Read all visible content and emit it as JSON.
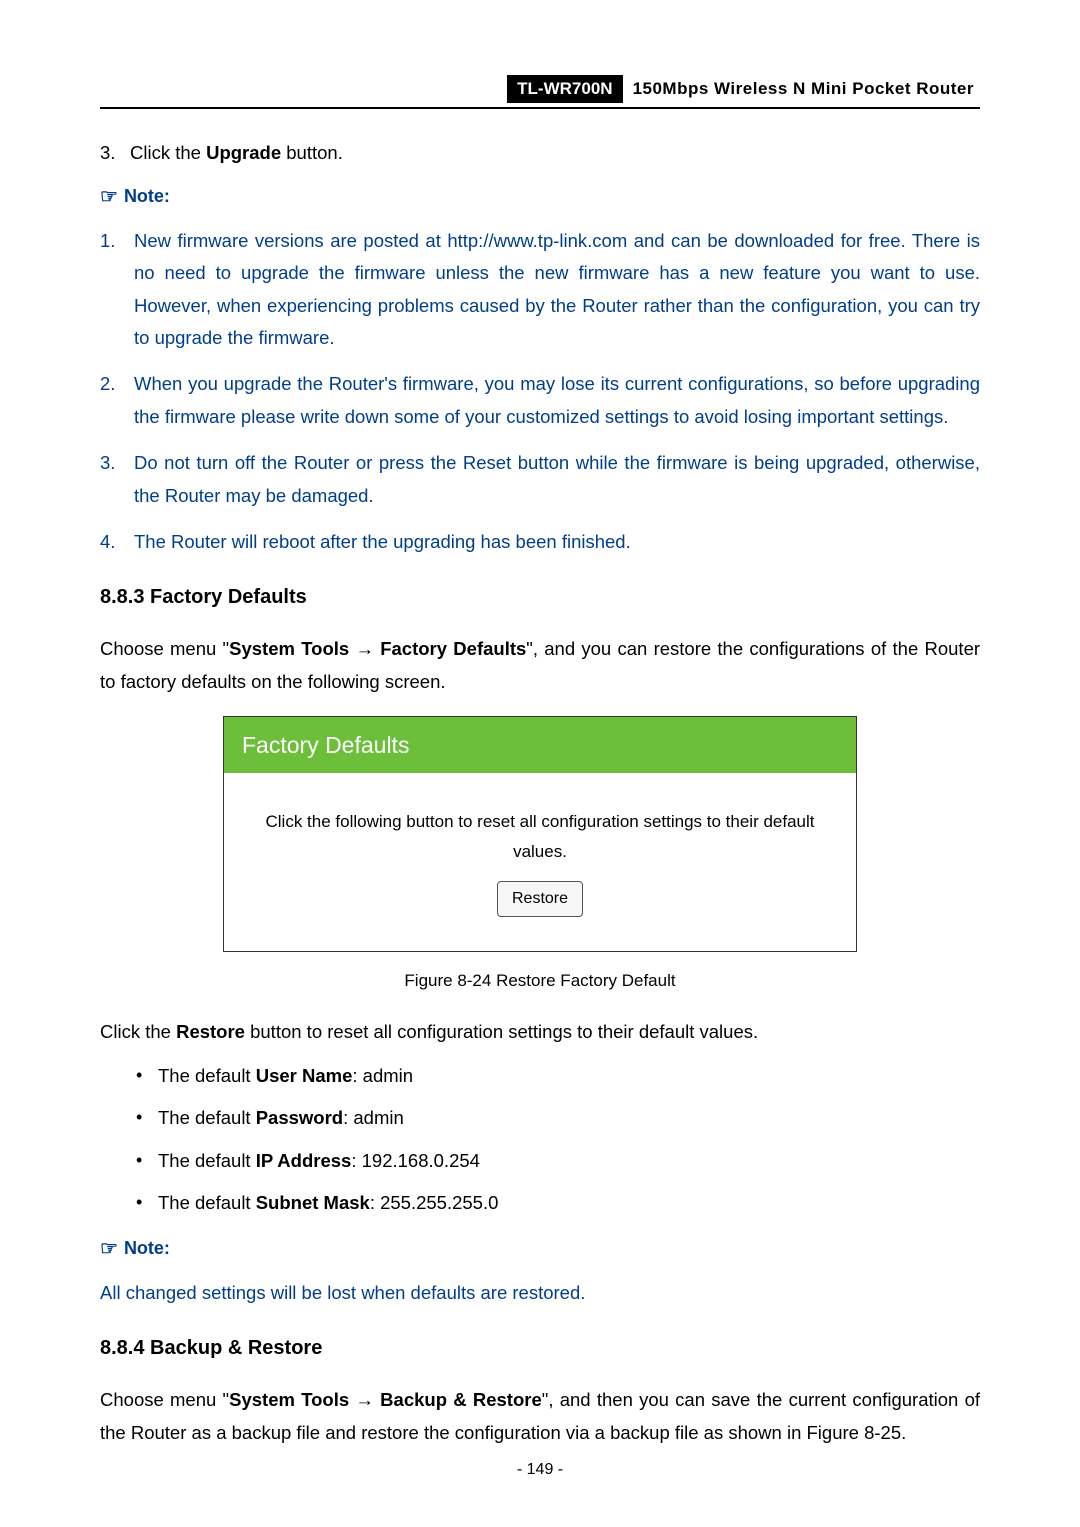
{
  "header": {
    "model": "TL-WR700N",
    "product": "150Mbps Wireless N Mini Pocket Router"
  },
  "step3": {
    "num": "3.",
    "prefix": "Click the ",
    "bold": "Upgrade",
    "suffix": " button."
  },
  "note_label": "Note:",
  "notes1": {
    "items": [
      {
        "num": "1.",
        "text": "New firmware versions are posted at http://www.tp-link.com and can be downloaded for free. There is no need to upgrade the firmware unless the new firmware has a new feature you want to use. However, when experiencing problems caused by the Router rather than the configuration, you can try to upgrade the firmware."
      },
      {
        "num": "2.",
        "text": "When you upgrade the Router's firmware, you may lose its current configurations, so before upgrading the firmware please write down some of your customized settings to avoid losing important settings."
      },
      {
        "num": "3.",
        "text": "Do not turn off the Router or press the Reset button while the firmware is being upgraded, otherwise, the Router may be damaged."
      },
      {
        "num": "4.",
        "text": "The Router will reboot after the upgrading has been finished."
      }
    ]
  },
  "section883": {
    "heading": "8.8.3  Factory Defaults",
    "intro_prefix": "Choose menu \"",
    "intro_bold1": "System Tools",
    "intro_arrow": " → ",
    "intro_bold2": "Factory Defaults",
    "intro_suffix": "\", and you can restore the configurations of the Router to factory defaults on the following screen."
  },
  "figure": {
    "title": "Factory Defaults",
    "instruction": "Click the following button to reset all configuration settings to their default values.",
    "button_label": "Restore",
    "caption": "Figure 8-24 Restore Factory Default"
  },
  "restore_para": {
    "prefix": "Click the ",
    "bold": "Restore",
    "suffix": " button to reset all configuration settings to their default values."
  },
  "defaults_bullets": [
    {
      "pre": "The default ",
      "bold": "User Name",
      "post": ": admin"
    },
    {
      "pre": "The default ",
      "bold": "Password",
      "post": ": admin"
    },
    {
      "pre": "The default ",
      "bold": "IP Address",
      "post": ": 192.168.0.254"
    },
    {
      "pre": "The default ",
      "bold": "Subnet Mask",
      "post": ": 255.255.255.0"
    }
  ],
  "note2_text": "All changed settings will be lost when defaults are restored.",
  "section884": {
    "heading": "8.8.4  Backup & Restore",
    "intro_prefix": "Choose menu \"",
    "intro_bold1": "System Tools",
    "intro_arrow": " → ",
    "intro_bold2": "Backup & Restore",
    "intro_suffix": "\", and then you can save the current configuration of the Router as a backup file and restore the configuration via a backup file as shown in Figure 8-25."
  },
  "page_number": "- 149 -"
}
